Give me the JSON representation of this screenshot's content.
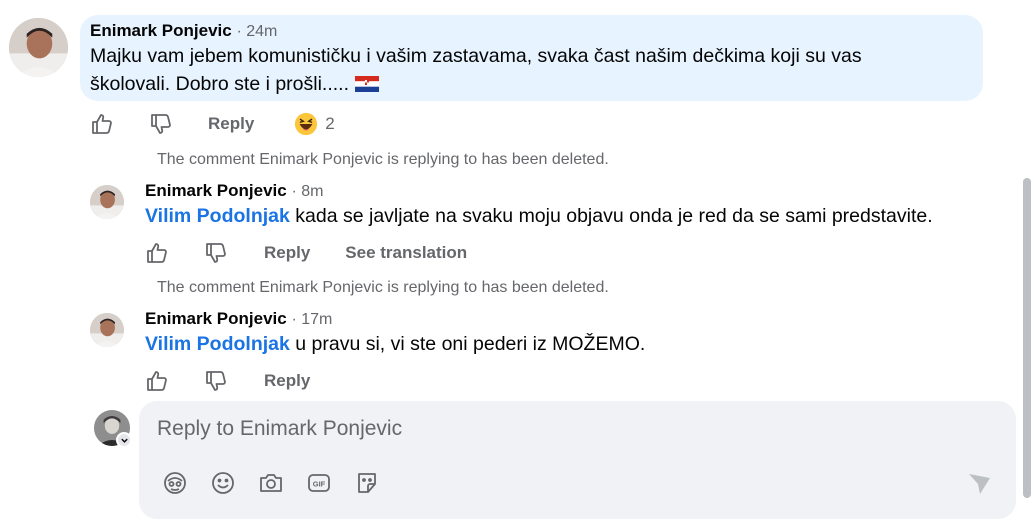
{
  "top_comment": {
    "author": "Enimark Ponjevic",
    "time": "· 24m",
    "text_line1": "Majku vam jebem komunističku i vašim zastavama, svaka čast našim dečkima koji su vas",
    "text_line2": "školovali. Dobro ste i prošli.....",
    "flag": "🇭🇷",
    "reply_label": "Reply",
    "reaction_count": "2"
  },
  "deleted_notice": "The comment Enimark Ponjevic is replying to has been deleted.",
  "reply1": {
    "author": "Enimark Ponjevic",
    "time": "· 8m",
    "mention": "Vilim Podolnjak",
    "text": "kada se javljate na svaku moju objavu onda je red da se sami predstavite.",
    "reply_label": "Reply",
    "translate_label": "See translation"
  },
  "reply2": {
    "author": "Enimark Ponjevic",
    "time": "· 17m",
    "mention": "Vilim Podolnjak",
    "text": "u pravu si, vi ste oni pederi iz MOŽEMO.",
    "reply_label": "Reply"
  },
  "composer": {
    "placeholder": "Reply to Enimark Ponjevic"
  },
  "colors": {
    "bubble": "#e7f3ff",
    "mention": "#1b74e4",
    "secondary_text": "#65676b"
  }
}
